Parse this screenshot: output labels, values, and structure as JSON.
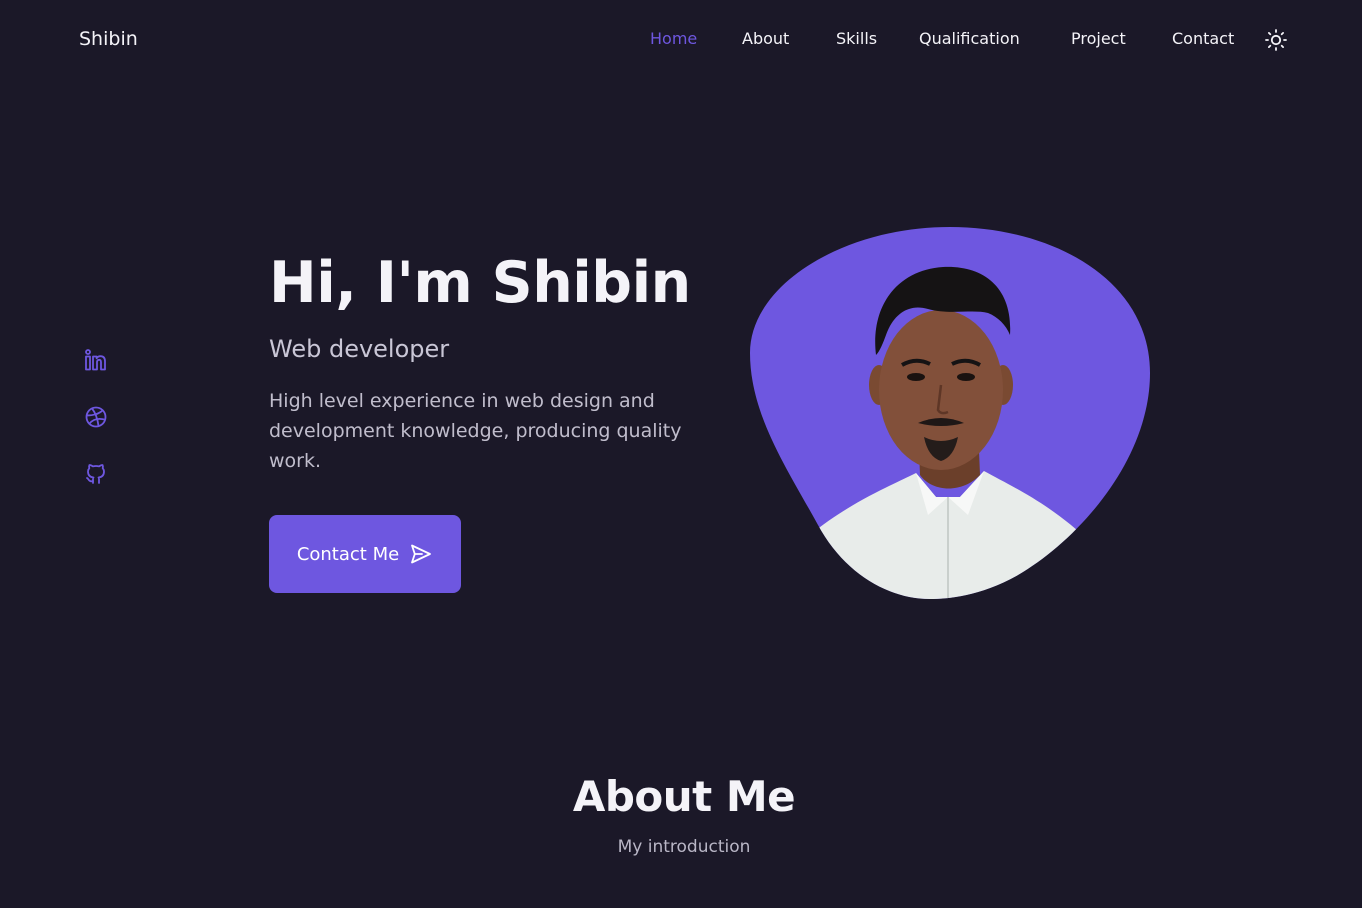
{
  "header": {
    "logo": "Shibin",
    "nav": [
      {
        "label": "Home",
        "active": true
      },
      {
        "label": "About",
        "active": false
      },
      {
        "label": "Skills",
        "active": false
      },
      {
        "label": "Qualification",
        "active": false
      },
      {
        "label": "Project",
        "active": false
      },
      {
        "label": "Contact",
        "active": false
      }
    ],
    "theme_toggle_icon": "sun-icon"
  },
  "social": {
    "icons": [
      "linkedin-icon",
      "dribbble-icon",
      "github-icon"
    ]
  },
  "hero": {
    "title": "Hi, I'm Shibin",
    "subtitle": "Web developer",
    "description": "High level experience in web design and development knowledge, producing quality work.",
    "button_label": "Contact Me",
    "button_icon": "send-icon"
  },
  "about": {
    "title": "About Me",
    "subtitle": "My introduction"
  },
  "colors": {
    "background": "#1b1828",
    "accent": "#6e57e0",
    "text": "#f4f3f8",
    "muted_text": "#c0bdcc"
  }
}
